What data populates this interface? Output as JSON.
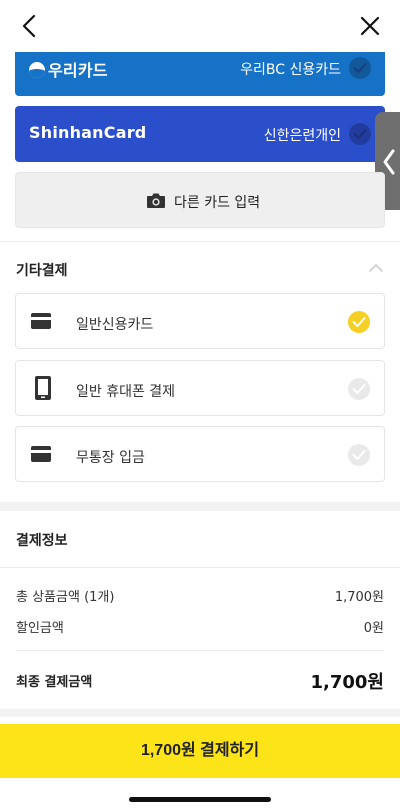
{
  "header": {
    "back_icon": "chevron-left-icon",
    "close_icon": "close-icon"
  },
  "cards": [
    {
      "logo": "우리카드",
      "name": "우리BC 신용카드",
      "color": "#1672c6"
    },
    {
      "logo": "ShinhanCard",
      "name": "신한은련개인",
      "color": "#2b4ecb"
    }
  ],
  "other_card": {
    "label": "다른 카드 입력",
    "icon": "camera-icon"
  },
  "side_tab": {
    "icon": "chevron-left-icon"
  },
  "other_payment": {
    "title": "기타결제",
    "options": [
      {
        "label": "일반신용카드",
        "icon": "credit-card-icon",
        "selected": true
      },
      {
        "label": "일반 휴대폰 결제",
        "icon": "phone-icon",
        "selected": false
      },
      {
        "label": "무통장 입금",
        "icon": "bank-card-icon",
        "selected": false
      }
    ]
  },
  "payment_info": {
    "title": "결제정보",
    "rows": [
      {
        "label": "총 상품금액 (1개)",
        "value": "1,700원"
      },
      {
        "label": "할인금액",
        "value": "0원"
      }
    ],
    "final_label": "최종 결제금액",
    "final_value": "1,700원"
  },
  "pay_button": {
    "label": "1,700원 결제하기",
    "color": "#fde418"
  }
}
